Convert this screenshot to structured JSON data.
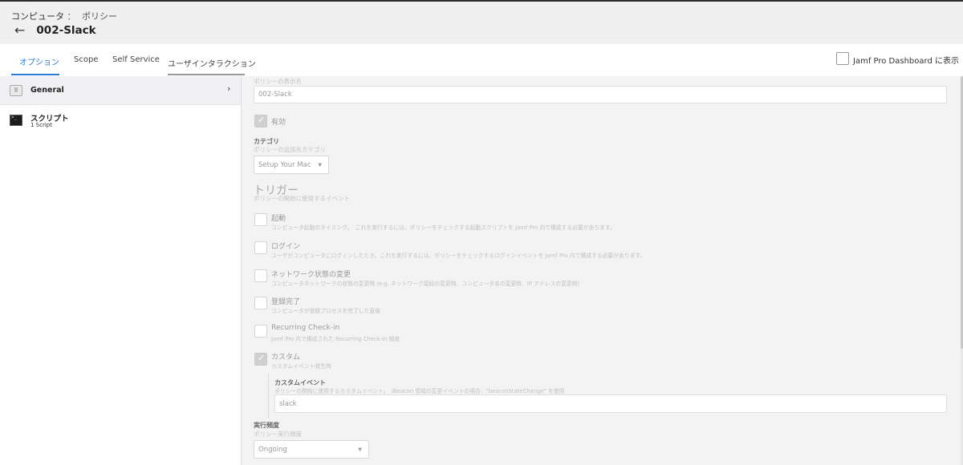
{
  "header": {
    "breadcrumb_1": "コンピュータ",
    "breadcrumb_sep": "：",
    "breadcrumb_2": "ポリシー",
    "back_arrow": "←",
    "title": "002-Slack"
  },
  "tabs": [
    {
      "label": "オプション",
      "active": true
    },
    {
      "label": "Scope",
      "active": false
    },
    {
      "label": "Self Service",
      "active": false
    },
    {
      "label": "ユーザインタラクション",
      "active": false
    }
  ],
  "dashboard_toggle": {
    "label": "Jamf Pro Dashboard に表示",
    "checked": false
  },
  "sidebar": {
    "items": [
      {
        "label": "General",
        "icon": "general-icon",
        "chevron": "›",
        "selected": true
      },
      {
        "label": "スクリプト",
        "sub": "1 Script",
        "icon": "terminal-icon"
      }
    ]
  },
  "general": {
    "display_name_label": "ポリシーの表示名",
    "display_name_value": "002-Slack",
    "enabled_label": "有効",
    "enabled_checked": true,
    "category_title": "カテゴリ",
    "category_desc": "ポリシーの追加先カテゴリ",
    "category_value": "Setup Your Mac",
    "trigger_title": "トリガー",
    "trigger_desc": "ポリシーの開始に使用するイベント",
    "triggers": [
      {
        "title": "起動",
        "desc": "コンピュータ起動のタイミング。　これを実行するには、ポリシーをチェックする起動スクリプトを Jamf Pro 内で構成する必要があります。",
        "checked": false
      },
      {
        "title": "ログイン",
        "desc": "ユーザがコンピュータにログインしたとき。これを実行するには、ポリシーをチェックするログインイベントを Jamf Pro 内で構成する必要があります。",
        "checked": false
      },
      {
        "title": "ネットワーク状態の変更",
        "desc": "コンピュータネットワークの状態の変更時 (e.g. ネットワーク接続の変更時、コンピュータ名の変更時、IP アドレスの変更時)",
        "checked": false
      },
      {
        "title": "登録完了",
        "desc": "コンピュータが登録プロセスを完了した直後",
        "checked": false
      },
      {
        "title": "Recurring Check-in",
        "desc": "Jamf Pro 内で構成された Recurring Check-in 頻度",
        "checked": false
      },
      {
        "title": "カスタム",
        "desc": "カスタムイベント発生時",
        "checked": true
      }
    ],
    "custom_event_title": "カスタムイベント",
    "custom_event_desc": "ポリシーの開始に使用するカスタムイベント。　iBeacon 領域の変更イベントの場合、\"beaconStateChange\" を使用",
    "custom_event_value": "slack",
    "frequency_title": "実行頻度",
    "frequency_desc": "ポリシー実行頻度",
    "frequency_value": "Ongoing",
    "caret": "▼"
  }
}
